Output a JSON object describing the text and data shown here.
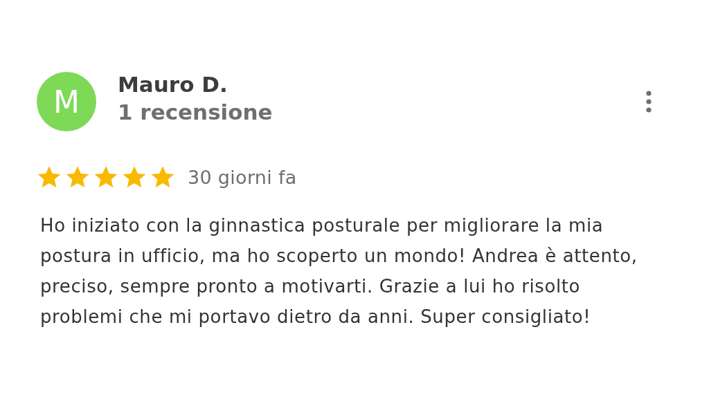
{
  "review": {
    "avatar_letter": "M",
    "author": "Mauro D.",
    "review_count": "1 recensione",
    "stars": 5,
    "date": "30 giorni fa",
    "text": "Ho iniziato con la ginnastica posturale per migliorare la mia postura in ufficio, ma ho scoperto un mondo! Andrea è attento, preciso, sempre pronto a motivarti. Grazie a lui ho risolto problemi che mi portavo dietro da anni. Super consigliato!"
  }
}
